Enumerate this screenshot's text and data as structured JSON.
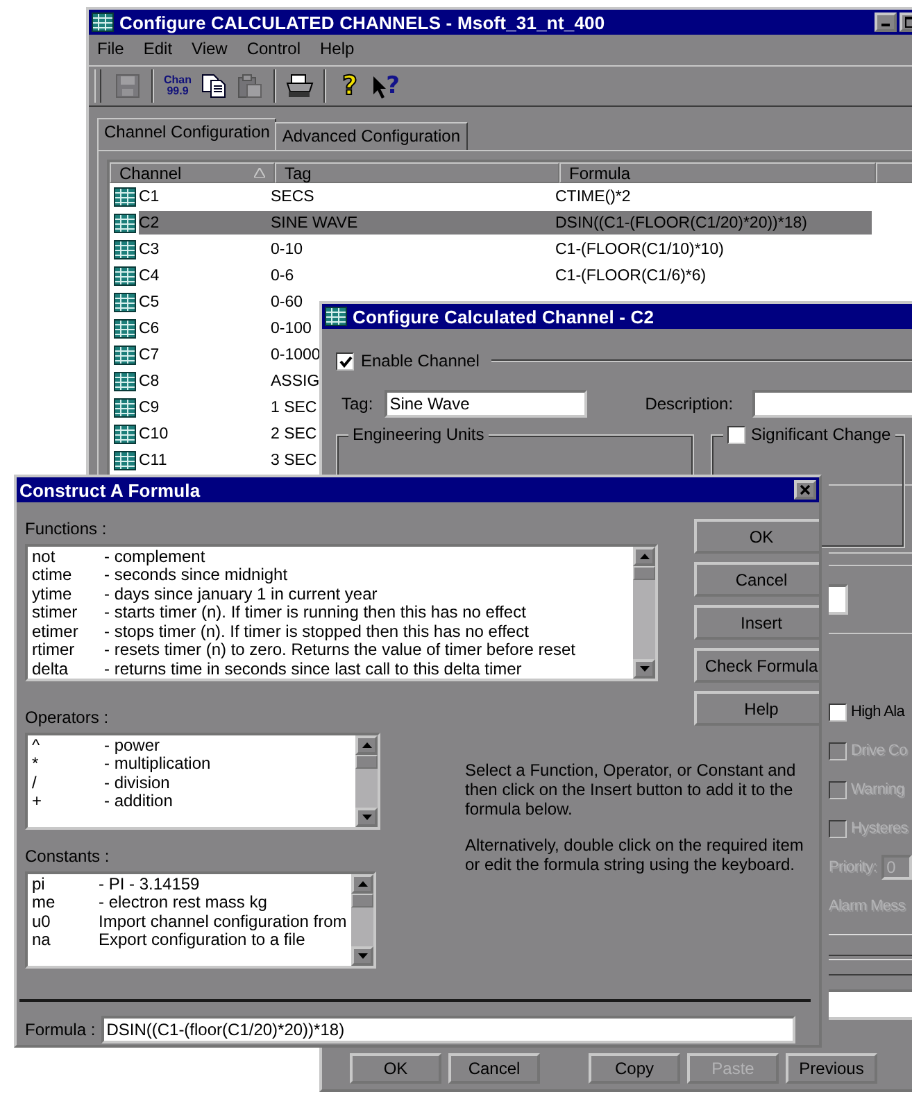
{
  "main_window": {
    "title": "Configure CALCULATED CHANNELS - Msoft_31_nt_400",
    "menu": [
      "File",
      "Edit",
      "View",
      "Control",
      "Help"
    ],
    "toolbar": [
      {
        "kind": "save",
        "disabled": true,
        "separator_before": false
      },
      {
        "kind": "channel",
        "lines": [
          "Chan",
          "99.9"
        ],
        "disabled": false,
        "separator_before": true
      },
      {
        "kind": "copy",
        "disabled": false,
        "separator_before": false
      },
      {
        "kind": "paste",
        "disabled": true,
        "separator_before": false
      },
      {
        "kind": "print",
        "disabled": false,
        "separator_before": true
      },
      {
        "kind": "help",
        "glyph": "?",
        "disabled": false,
        "separator_before": true
      },
      {
        "kind": "context_help",
        "glyph": "?",
        "disabled": false,
        "separator_before": false
      }
    ],
    "tabs": [
      {
        "label": "Channel Configuration",
        "selected": true
      },
      {
        "label": "Advanced Configuration",
        "selected": false
      }
    ],
    "table": {
      "columns": [
        {
          "label": "Channel",
          "sorted": true
        },
        {
          "label": "Tag",
          "sorted": false
        },
        {
          "label": "Formula",
          "sorted": false
        }
      ],
      "rows": [
        {
          "channel": "C1",
          "tag": "SECS",
          "formula": "CTIME()*2",
          "selected": false
        },
        {
          "channel": "C2",
          "tag": "SINE WAVE",
          "formula": "DSIN((C1-(FLOOR(C1/20)*20))*18)",
          "selected": true
        },
        {
          "channel": "C3",
          "tag": "0-10",
          "formula": "C1-(FLOOR(C1/10)*10)",
          "selected": false
        },
        {
          "channel": "C4",
          "tag": "0-6",
          "formula": "C1-(FLOOR(C1/6)*6)",
          "selected": false
        },
        {
          "channel": "C5",
          "tag": "0-60",
          "selected": false
        },
        {
          "channel": "C6",
          "tag": "0-100",
          "selected": false
        },
        {
          "channel": "C7",
          "tag": "0-1000",
          "selected": false
        },
        {
          "channel": "C8",
          "tag": "ASSIG",
          "selected": false
        },
        {
          "channel": "C9",
          "tag": "1 SEC",
          "selected": false
        },
        {
          "channel": "C10",
          "tag": "2 SEC",
          "selected": false
        },
        {
          "channel": "C11",
          "tag": "3 SEC",
          "selected": false
        }
      ]
    }
  },
  "channel_dialog": {
    "title": "Configure Calculated Channel - C2",
    "enable": {
      "label": "Enable Channel",
      "checked": true
    },
    "tag": {
      "label": "Tag:",
      "value": "Sine Wave"
    },
    "description": {
      "label": "Description:"
    },
    "engineering_units": {
      "label": "Engineering Units"
    },
    "significant_change": {
      "label": "Significant Change",
      "checked": false
    },
    "alarm_options": [
      {
        "label": "High Ala",
        "checked": false,
        "disabled": false
      },
      {
        "label": "Drive Co",
        "checked": false,
        "disabled": true
      },
      {
        "label": "Warning",
        "checked": false,
        "disabled": true
      },
      {
        "label": "Hysteres",
        "checked": false,
        "disabled": true
      }
    ],
    "priority": {
      "label": "Priority:",
      "value": "0",
      "disabled": true
    },
    "alarm_message": {
      "label": "Alarm Mess",
      "disabled": true
    },
    "buttons": [
      {
        "label": "OK",
        "disabled": false
      },
      {
        "label": "Cancel",
        "disabled": false
      },
      {
        "label": "Copy",
        "disabled": false
      },
      {
        "label": "Paste",
        "disabled": true
      },
      {
        "label": "Previous",
        "disabled": false
      }
    ]
  },
  "formula_dialog": {
    "title": "Construct A Formula",
    "functions": {
      "label": "Functions :",
      "items": [
        {
          "name": "not",
          "description": "- complement",
          "selected": false
        },
        {
          "name": "ctime",
          "description": "- seconds since midnight",
          "selected": false
        },
        {
          "name": "ytime",
          "description": "- days since january 1 in current year",
          "selected": false
        },
        {
          "name": "stimer",
          "description": "- starts timer (n). If timer is running then this has no effect",
          "selected": false
        },
        {
          "name": "etimer",
          "description": "- stops timer (n). If timer is stopped then this has no effect",
          "selected": false
        },
        {
          "name": "rtimer",
          "description": "- resets timer (n) to zero. Returns the value of timer before reset",
          "selected": false
        },
        {
          "name": "delta",
          "description": "- returns time in seconds since last call to this delta timer",
          "selected": false
        }
      ]
    },
    "operators": {
      "label": "Operators :",
      "items": [
        {
          "name": "^",
          "description": "- power",
          "selected": false
        },
        {
          "name": "*",
          "description": "- multiplication",
          "selected": false
        },
        {
          "name": "/",
          "description": "- division",
          "selected": false
        },
        {
          "name": "+",
          "description": "- addition",
          "selected": false
        }
      ]
    },
    "constants": {
      "label": "Constants :",
      "items": [
        {
          "name": "pi",
          "description": "- PI - 3.14159",
          "selected": false
        },
        {
          "name": "me",
          "description": "- electron rest mass kg",
          "selected": false
        },
        {
          "name": "u0",
          "description": "Import channel configuration from",
          "selected": false
        },
        {
          "name": "na",
          "description": "Export configuration to a file",
          "selected": false
        }
      ]
    },
    "buttons": [
      {
        "label": "OK"
      },
      {
        "label": "Cancel"
      },
      {
        "label": "Insert"
      },
      {
        "label": "Check Formula"
      },
      {
        "label": "Help"
      }
    ],
    "instructions": [
      "Select a Function, Operator, or Constant and then click on the Insert button to add it to the formula below.",
      "Alternatively, double click on the required item or edit the formula string using the keyboard."
    ],
    "formula": {
      "label": "Formula :",
      "value": "DSIN((C1-(floor(C1/20)*20))*18)"
    }
  }
}
